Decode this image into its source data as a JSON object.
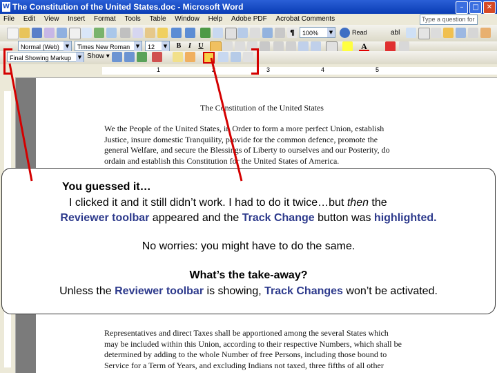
{
  "window": {
    "title": "The Constitution of the United States.doc - Microsoft Word"
  },
  "menu": {
    "items": [
      "File",
      "Edit",
      "View",
      "Insert",
      "Format",
      "Tools",
      "Table",
      "Window",
      "Help",
      "Adobe PDF",
      "Acrobat Comments"
    ],
    "help_placeholder": "Type a question for help"
  },
  "toolbar": {
    "zoom": "100%",
    "read_label": "Read"
  },
  "format_bar": {
    "style": "Normal (Web)",
    "font": "Times New Roman",
    "size": "12",
    "bold": "B",
    "italic": "I",
    "underline": "U"
  },
  "review_bar": {
    "display": "Final Showing Markup",
    "show_label": "Show"
  },
  "ruler": {
    "marks": [
      "1",
      "2",
      "3",
      "4",
      "5"
    ]
  },
  "document": {
    "title": "The Constitution of the United States",
    "preamble": [
      "We the People of the United States, in Order to form a more perfect Union, establish",
      "Justice, insure domestic Tranquility, provide for the common defence, promote the",
      "general Welfare, and secure the Blessings of Liberty to ourselves and our Posterity, do",
      "ordain and establish this Constitution for the United States of America."
    ],
    "paragraph": [
      "Representatives and direct Taxes shall be apportioned among the several States which",
      "may be included within this Union, according to their respective Numbers, which shall be",
      "determined by adding to the whole Number of free Persons, including those bound to",
      "Service for a Term of Years, and excluding Indians not taxed, three fifths of all other"
    ]
  },
  "callout": {
    "heading": "You guessed it…",
    "line1_a": "I clicked it and it still didn’t work. I had to do it twice…but ",
    "line1_em": "then",
    "line1_b": " the",
    "line2_reviewer": "Reviewer toolbar",
    "line2_mid": " appeared and the ",
    "line2_track": "Track Change",
    "line2_mid2": " button was ",
    "line2_highlighted": "highlighted.",
    "worries": "No worries: you might have to do the same.",
    "takeaway": "What’s the take-away?",
    "last_a": "Unless the ",
    "last_reviewer": "Reviewer toolbar",
    "last_mid": " is showing, ",
    "last_track": "Track Changes",
    "last_b": " won’t be activated."
  },
  "colors": {
    "annotation": "#d40000",
    "highlight_text": "#2d3a8c",
    "title_bar": "#0a3db5"
  }
}
